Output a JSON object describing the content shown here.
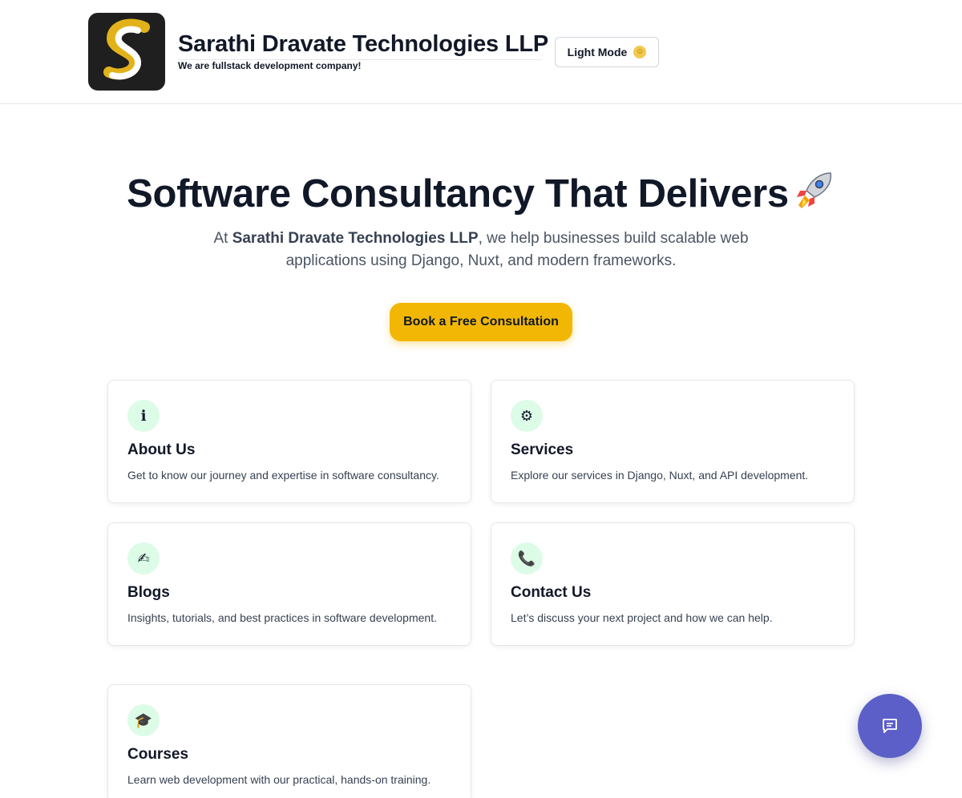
{
  "header": {
    "brand_name": "Sarathi Dravate Technologies LLP",
    "tagline": "We are fullstack development company!",
    "mode_button_label": "Light Mode",
    "mode_icon": "sun-face-icon"
  },
  "hero": {
    "title": "Software Consultancy That Delivers",
    "title_icon": "rocket-icon",
    "sub_prefix": "At ",
    "sub_brand": "Sarathi Dravate Technologies LLP",
    "sub_rest": ", we help businesses build scalable web applications using Django, Nuxt, and modern frameworks.",
    "cta_label": "Book a Free Consultation"
  },
  "cards": [
    {
      "icon": "info-icon",
      "glyph": "ℹ",
      "title": "About Us",
      "description": "Get to know our journey and expertise in software consultancy."
    },
    {
      "icon": "gear-icon",
      "glyph": "⚙",
      "title": "Services",
      "description": "Explore our services in Django, Nuxt, and API development."
    },
    {
      "icon": "writing-hand-icon",
      "glyph": "✍",
      "title": "Blogs",
      "description": "Insights, tutorials, and best practices in software development."
    },
    {
      "icon": "phone-icon",
      "glyph": "📞",
      "title": "Contact Us",
      "description": "Let’s discuss your next project and how we can help."
    },
    {
      "icon": "graduation-cap-icon",
      "glyph": "🎓",
      "title": "Courses",
      "description": "Learn web development with our practical, hands-on training."
    }
  ],
  "chat": {
    "icon": "chat-icon"
  },
  "colors": {
    "accent": "#f2b705",
    "chat": "#5b5fc7",
    "icon_bg": "#dcfce7",
    "text": "#111827"
  }
}
